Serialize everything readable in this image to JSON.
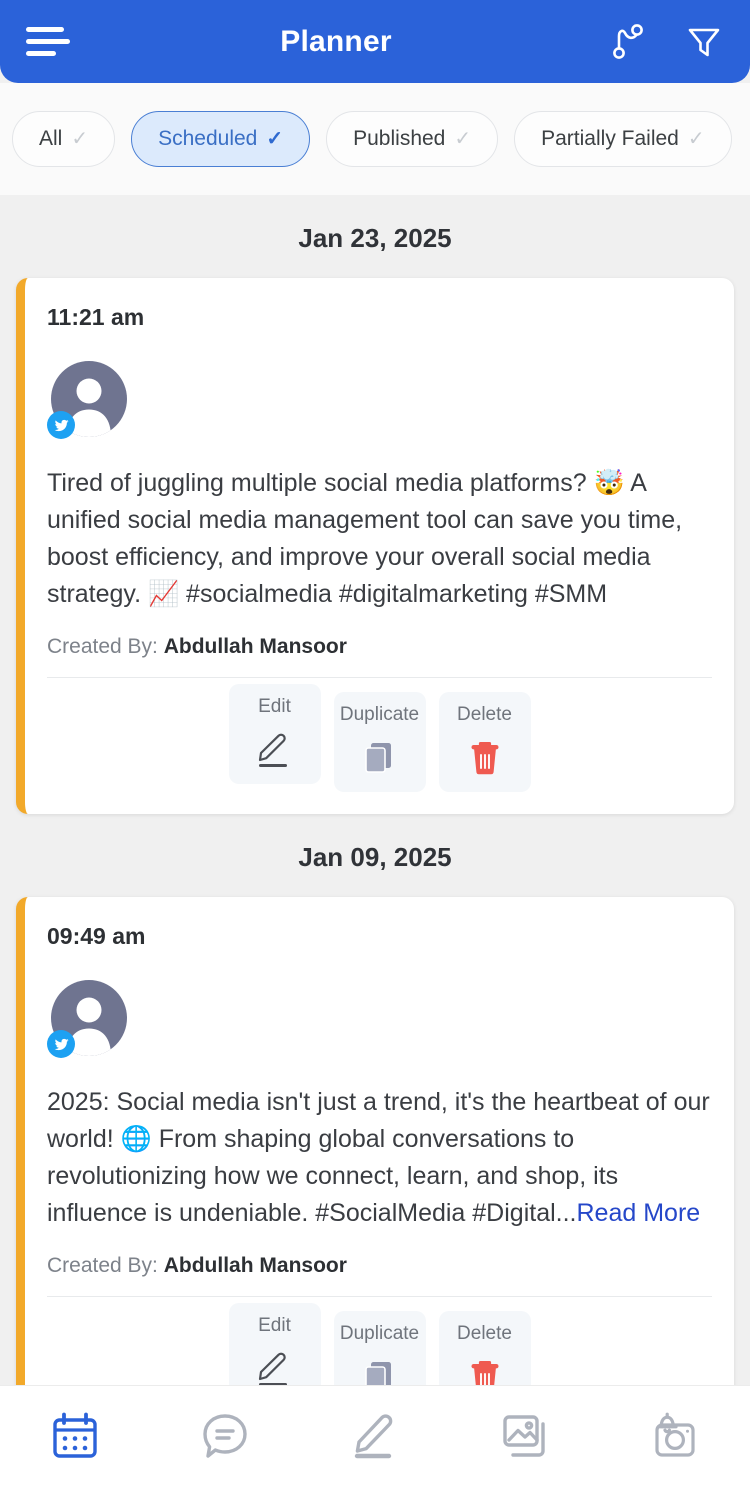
{
  "header": {
    "title": "Planner",
    "menu_icon": "hamburger-menu-icon",
    "branch_icon": "branch-merge-icon",
    "filter_icon": "funnel-filter-icon"
  },
  "filters": {
    "chips": [
      {
        "label": "All",
        "selected": false
      },
      {
        "label": "Scheduled",
        "selected": true
      },
      {
        "label": "Published",
        "selected": false
      },
      {
        "label": "Partially Failed",
        "selected": false
      }
    ],
    "check_glyph": "✓"
  },
  "groups": [
    {
      "date": "Jan 23, 2025",
      "posts": [
        {
          "time": "11:21 am",
          "network": "twitter",
          "text": "Tired of juggling multiple social media platforms? 🤯 A unified social media management tool can save you time, boost efficiency, and improve your overall social media strategy. 📈 #socialmedia #digitalmarketing #SMM",
          "read_more": "",
          "created_by_label": "Created By:",
          "created_by_name": "Abdullah Mansoor",
          "actions": [
            {
              "label": "Edit",
              "icon": "pencil-icon"
            },
            {
              "label": "Duplicate",
              "icon": "copy-pages-icon"
            },
            {
              "label": "Delete",
              "icon": "trash-can-icon"
            }
          ]
        }
      ]
    },
    {
      "date": "Jan 09, 2025",
      "posts": [
        {
          "time": "09:49 am",
          "network": "twitter",
          "text": "2025: Social media isn't just a trend, it's the heartbeat of our world! 🌐 From shaping global conversations to revolutionizing how we connect, learn, and shop, its influence is undeniable. #SocialMedia #Digital...",
          "read_more": "Read More",
          "created_by_label": "Created By:",
          "created_by_name": "Abdullah Mansoor",
          "actions": [
            {
              "label": "Edit",
              "icon": "pencil-icon"
            },
            {
              "label": "Duplicate",
              "icon": "copy-pages-icon"
            },
            {
              "label": "Delete",
              "icon": "trash-can-icon"
            }
          ]
        }
      ]
    }
  ],
  "bottom_nav": {
    "items": [
      {
        "name": "calendar",
        "icon": "calendar-icon",
        "active": true
      },
      {
        "name": "messages",
        "icon": "chat-bubble-icon",
        "active": false
      },
      {
        "name": "compose",
        "icon": "pencil-compose-icon",
        "active": false
      },
      {
        "name": "media",
        "icon": "image-gallery-icon",
        "active": false
      },
      {
        "name": "notifications",
        "icon": "camera-bell-icon",
        "active": false
      }
    ]
  },
  "colors": {
    "header_blue": "#2b62d9",
    "accent_stripe": "#f2a92a",
    "chip_selected_bg": "#dceafc",
    "chip_selected_text": "#3a6fc4",
    "delete_red": "#e8534a",
    "link_blue": "#2547c9",
    "twitter_blue": "#1da1f2"
  }
}
